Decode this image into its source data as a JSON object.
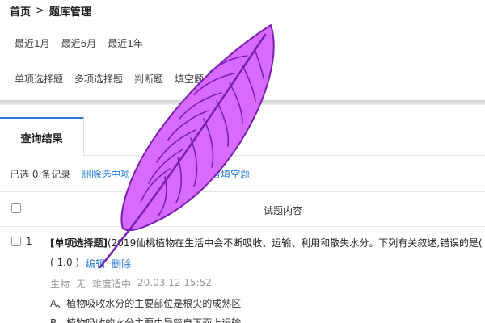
{
  "breadcrumb": {
    "home": "首页",
    "separator": ">",
    "current": "题库管理"
  },
  "time_filters": [
    "最近1月",
    "最近6月",
    "最近1年"
  ],
  "type_filters": [
    "单项选择题",
    "多项选择题",
    "判断题",
    "填空题"
  ],
  "tab": {
    "label": "查询结果"
  },
  "actions": {
    "selected": "已选 0 条记录",
    "delete": "删除选中项",
    "set_fill": "设置填空题"
  },
  "table": {
    "header": "试题内容"
  },
  "question": {
    "index": "1",
    "tag": "[单项选择题]",
    "text": "(2019仙桃植物在生活中会不断吸收、运输、利用和散失水分。下列有关叙述,错误的是(",
    "score": "( 1.0 )",
    "edit": "编辑",
    "delete": "删除",
    "subject": "生物",
    "none": "无",
    "difficulty": "难度适中",
    "time": "20.03.12 15:52",
    "option_a": "A、植物吸收水分的主要部位是根尖的成熟区",
    "option_b": "B、植物吸收的水分主要由导管自下而上运输"
  },
  "colors": {
    "link": "#2a7fd4",
    "feather": "#d86bff",
    "feather_stroke": "#7a1fb3"
  }
}
